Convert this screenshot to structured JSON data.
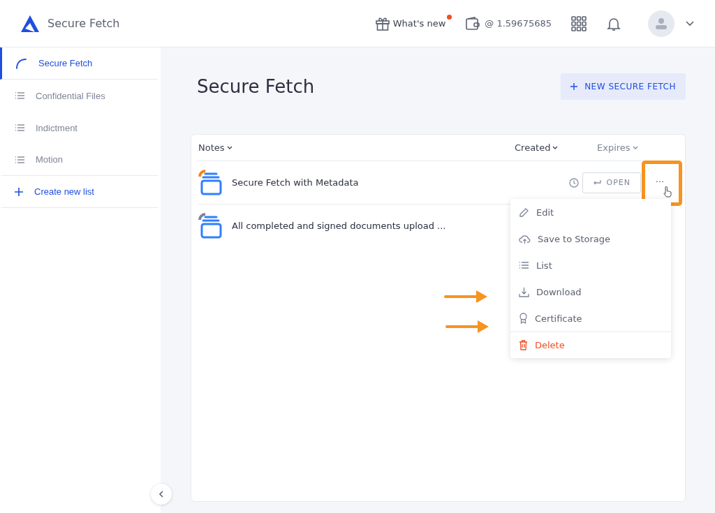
{
  "header": {
    "app_name": "Secure Fetch",
    "whats_new": {
      "label": "What's new",
      "unread": true
    },
    "balance": "@ 1.59675685"
  },
  "sidebar": {
    "items": [
      {
        "kind": "fetch",
        "label": "Secure Fetch",
        "selected": true
      },
      {
        "kind": "list",
        "label": "Confidential Files",
        "selected": false
      },
      {
        "kind": "list",
        "label": "Indictment",
        "selected": false
      },
      {
        "kind": "list",
        "label": "Motion",
        "selected": false
      },
      {
        "kind": "create",
        "label": "Create new list",
        "selected": false
      }
    ]
  },
  "page": {
    "title": "Secure Fetch",
    "new_button": "NEW SECURE FETCH"
  },
  "table": {
    "columns": [
      "Notes",
      "Created",
      "Expires"
    ],
    "rows": [
      {
        "name": "Secure Fetch with Metadata",
        "color": "#f5841f",
        "open_button": "OPEN",
        "more": "...",
        "menu_open": true
      },
      {
        "name": "All completed and signed documents upload ...",
        "color": "#7d8597",
        "menu_open": false
      }
    ]
  },
  "menu": [
    {
      "kind": "edit",
      "label": "Edit"
    },
    {
      "kind": "upload",
      "label": "Save to Storage"
    },
    {
      "kind": "list",
      "label": "List"
    },
    {
      "kind": "download",
      "label": "Download"
    },
    {
      "kind": "certificate",
      "label": "Certificate"
    },
    {
      "kind": "delete",
      "label": "Delete"
    }
  ]
}
